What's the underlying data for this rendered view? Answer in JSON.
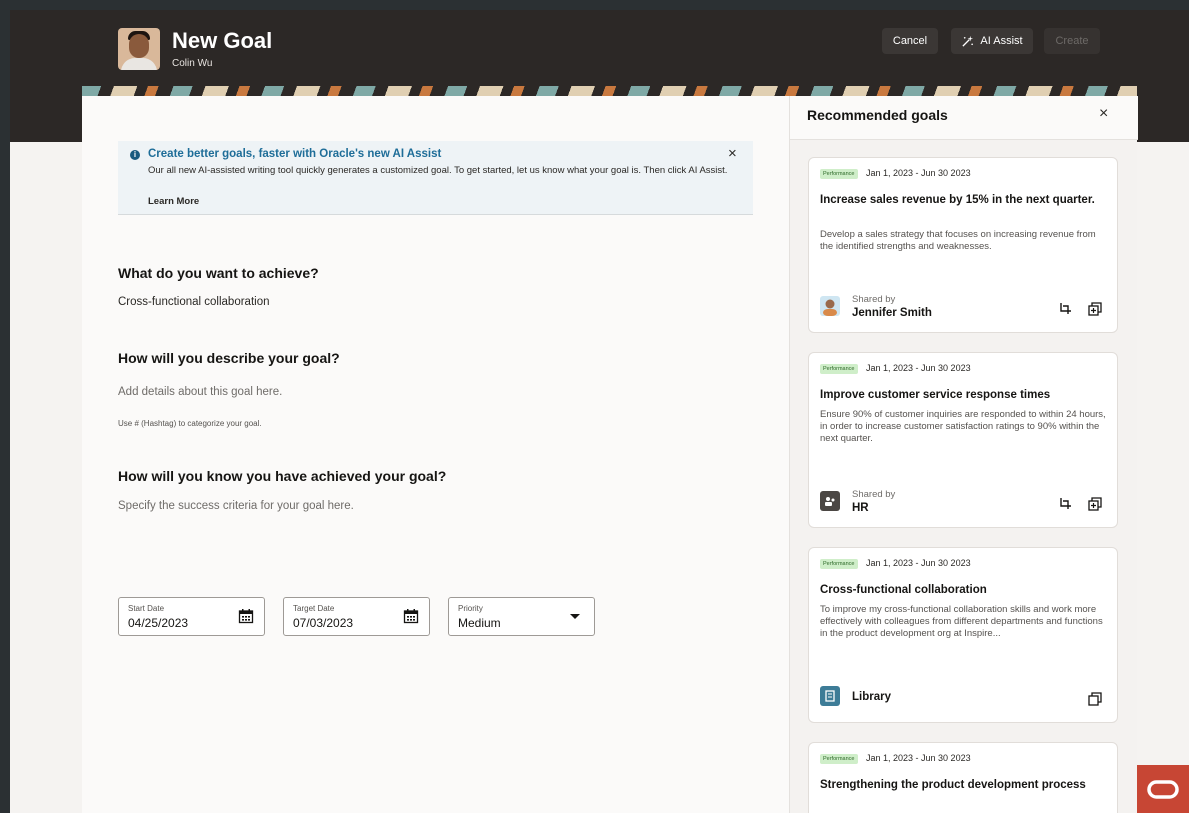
{
  "header": {
    "title": "New Goal",
    "subtitle": "Colin Wu",
    "cancel_label": "Cancel",
    "ai_assist_label": "AI Assist",
    "create_label": "Create"
  },
  "banner": {
    "title": "Create better goals, faster with Oracle's new AI Assist",
    "text": "Our all new AI-assisted writing tool quickly generates a customized goal. To get started, let us know what your goal is. Then click AI Assist.",
    "link": "Learn More",
    "info_glyph": "i",
    "close_glyph": "×"
  },
  "form": {
    "q1": "What do you want to achieve?",
    "q1_value": "Cross-functional collaboration",
    "q2": "How will you describe your goal?",
    "q2_placeholder": "Add details about this goal here.",
    "q2_hint": "Use # (Hashtag) to categorize your goal.",
    "q3": "How will you know you have achieved your goal?",
    "q3_placeholder": "Specify the success criteria for your goal here.",
    "start_label": "Start Date",
    "start_value": "04/25/2023",
    "target_label": "Target Date",
    "target_value": "07/03/2023",
    "priority_label": "Priority",
    "priority_value": "Medium"
  },
  "panel": {
    "title": "Recommended goals",
    "close_glyph": "×",
    "cards": [
      {
        "tag": "Performance",
        "date": "Jan 1, 2023 - Jun 30 2023",
        "title": "Increase sales revenue by 15% in the next quarter.",
        "desc": "Develop a sales strategy that focuses on increasing revenue from the identified strengths and weaknesses.",
        "shared_label": "Shared by",
        "shared_name": "Jennifer Smith"
      },
      {
        "tag": "Performance",
        "date": "Jan 1, 2023 - Jun 30 2023",
        "title": "Improve customer service response times",
        "desc": "Ensure 90% of customer inquiries are responded to within 24 hours, in order to increase customer satisfaction ratings to 90% within the next quarter.",
        "shared_label": "Shared by",
        "shared_name": "HR"
      },
      {
        "tag": "Performance",
        "date": "Jan 1, 2023 - Jun 30 2023",
        "title": "Cross-functional collaboration",
        "desc": "To improve my cross-functional collaboration skills and work more effectively with colleagues from different departments and functions in the product development org at Inspire...",
        "shared_name": "Library"
      },
      {
        "tag": "Performance",
        "date": "Jan 1, 2023 - Jun 30 2023",
        "title": "Strengthening the product development process"
      }
    ]
  },
  "icons": {
    "info": "info-icon",
    "close": "close-icon",
    "ai": "ai-sparkle-icon",
    "calendar": "calendar-icon",
    "caret": "chevron-down-icon",
    "add_goal": "add-to-goal-icon",
    "copy": "copy-icon",
    "brand": "oracle-logo"
  },
  "colors": {
    "header_bg": "#2c2826",
    "banner_title": "#1e6d98",
    "tag_bg": "#cfeec9",
    "brand_red": "#c74634"
  }
}
